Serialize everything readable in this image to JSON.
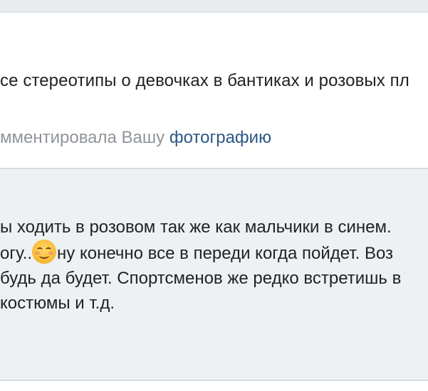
{
  "post": {
    "text": "се стереотипы о девочках в бантиках и розовых пл"
  },
  "notification": {
    "prefix": "мментировала Вашу ",
    "link": "фотографию"
  },
  "comment": {
    "line1": "ы ходить в розовом так же как мальчики в синем. ",
    "line2_before": "огу..",
    "emoji": "smiling-face-emoji",
    "line2_after": "ну конечно все в переди когда пойдет. Воз",
    "line3": "будь да будет. Спортсменов же редко встретишь в",
    "line4": " костюмы и т.д."
  },
  "colors": {
    "background": "#e7ebee",
    "card": "#ffffff",
    "comment_bg": "#edf1f3",
    "text": "#222222",
    "muted": "#8f9499",
    "link": "#2a5885"
  }
}
